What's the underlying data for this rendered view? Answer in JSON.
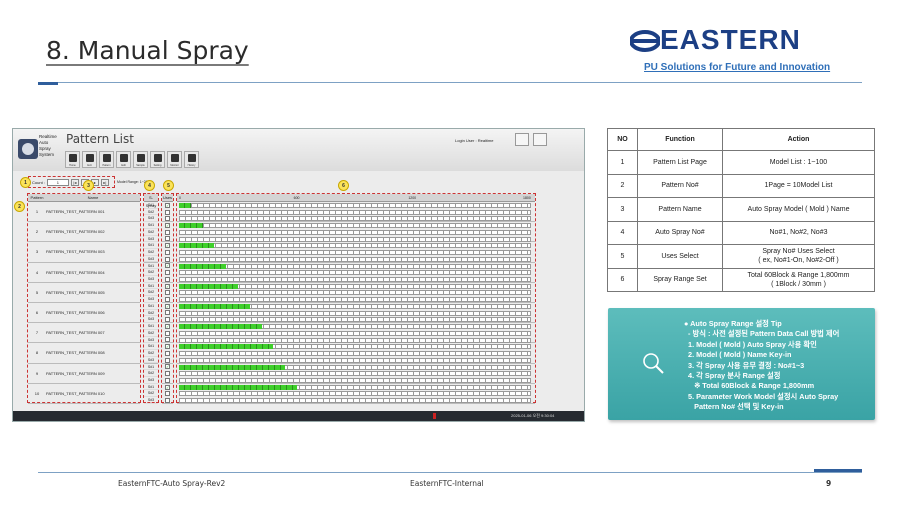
{
  "slide": {
    "title": "8. Manual Spray",
    "page_number": "9",
    "footer_left": "EasternFTC-Auto Spray-Rev2",
    "footer_center": "EasternFTC-Internal"
  },
  "brand": {
    "logo_text": "EASTERN",
    "tagline": "PU Solutions for Future and Innovation",
    "color": "#1c3f84"
  },
  "app": {
    "name_lines": [
      "Realtime",
      "Auto",
      "Spray",
      "System"
    ],
    "title": "Pattern List",
    "login_label": "Login User :",
    "login_user": "Realtime",
    "toolbar": [
      "Home",
      "Exit",
      "Pattern",
      "Edit",
      "Sample",
      "Setting",
      "Monitor",
      "History"
    ],
    "count_label": "Count :",
    "count_value": "1",
    "model_range_label": "Model Range: 1~20",
    "badges": [
      "1",
      "2",
      "3",
      "4",
      "5",
      "6"
    ],
    "headers": {
      "pattern": "Pattern",
      "name": "Name",
      "spray": "S-Spray",
      "uses": "Uses"
    },
    "axis": [
      "0",
      "600",
      "1200",
      "1800"
    ],
    "axis_max": 1800,
    "spray_labels": [
      "S#1",
      "S#2",
      "S#3"
    ],
    "patterns": [
      {
        "no": "1",
        "name": "PATTERN_TEST_PATTERN 001",
        "fill": 60,
        "uses": [
          true,
          false,
          false
        ]
      },
      {
        "no": "2",
        "name": "PATTERN_TEST_PATTERN 002",
        "fill": 120,
        "uses": [
          true,
          false,
          false
        ]
      },
      {
        "no": "3",
        "name": "PATTERN_TEST_PATTERN 003",
        "fill": 180,
        "uses": [
          true,
          false,
          false
        ]
      },
      {
        "no": "4",
        "name": "PATTERN_TEST_PATTERN 004",
        "fill": 240,
        "uses": [
          true,
          false,
          false
        ]
      },
      {
        "no": "5",
        "name": "PATTERN_TEST_PATTERN 005",
        "fill": 300,
        "uses": [
          true,
          false,
          false
        ]
      },
      {
        "no": "6",
        "name": "PATTERN_TEST_PATTERN 006",
        "fill": 360,
        "uses": [
          true,
          false,
          false
        ]
      },
      {
        "no": "7",
        "name": "PATTERN_TEST_PATTERN 007",
        "fill": 420,
        "uses": [
          true,
          false,
          false
        ]
      },
      {
        "no": "8",
        "name": "PATTERN_TEST_PATTERN 008",
        "fill": 480,
        "uses": [
          true,
          false,
          false
        ]
      },
      {
        "no": "9",
        "name": "PATTERN_TEST_PATTERN 009",
        "fill": 540,
        "uses": [
          true,
          false,
          false
        ]
      },
      {
        "no": "10",
        "name": "PATTERN_TEST_PATTERN 010",
        "fill": 600,
        "uses": [
          true,
          false,
          false
        ]
      }
    ],
    "status_time": "2025-01-06 오전 9:30:04"
  },
  "functions": {
    "headers": [
      "NO",
      "Function",
      "Action"
    ],
    "rows": [
      [
        "1",
        "Pattern List Page",
        "Model List : 1~100"
      ],
      [
        "2",
        "Pattern No#",
        "1Page = 10Model List"
      ],
      [
        "3",
        "Pattern Name",
        "Auto Spray Model ( Mold ) Name"
      ],
      [
        "4",
        "Auto Spray No#",
        "No#1, No#2, No#3"
      ],
      [
        "5",
        "Uses Select",
        "Spray No# Uses Select\n( ex, No#1-On, No#2-Off )"
      ],
      [
        "6",
        "Spray Range Set",
        "Total 60Block & Range 1,800mm\n( 1Block / 30mm )"
      ]
    ]
  },
  "tip": {
    "lines": [
      "● Auto Spray Range 설정 Tip",
      "  - 방식 : 사전 설정된 Pattern Data Call 방법 제어",
      "  1. Model ( Mold ) Auto Spray 사용 확인",
      "  2. Model ( Mold ) Name Key-in",
      "  3. 각 Spray 사용 유무 결정 : No#1~3",
      "  4. 각 Spray 분사 Range 설정",
      "     ※ Total 60Block & Range 1,800mm",
      "  5. Parameter Work Model 설정시 Auto Spray",
      "     Pattern No# 선택 및 Key-in"
    ]
  }
}
